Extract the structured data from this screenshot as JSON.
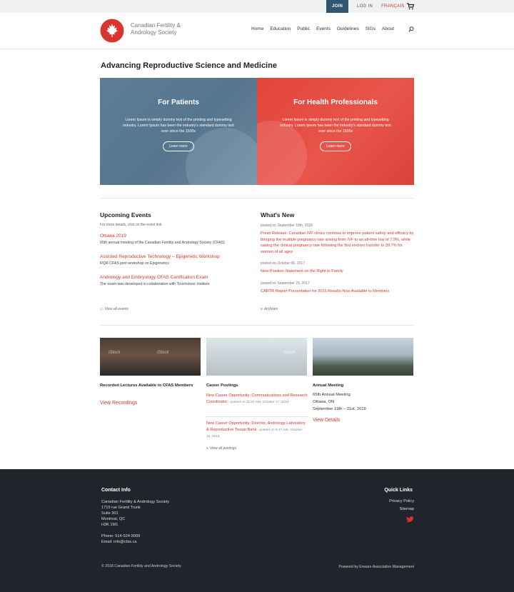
{
  "topbar": {
    "join": "JOIN",
    "login": "LOG IN",
    "lang": "FRANÇAIS",
    "cart_icon": "cart-icon"
  },
  "header": {
    "logo_text": "Canadian Fertility & Andrology Society",
    "nav": [
      "Home",
      "Education",
      "Public",
      "Events",
      "Guidelines",
      "SIGs",
      "About"
    ],
    "search_icon": "search-icon"
  },
  "page_title": "Advancing Reproductive Science and Medicine",
  "hero": [
    {
      "title": "For Patients",
      "text": "Lorem Ipsum is simply dummy text of the printing and typesetting industry. Lorem Ipsum has been the industry's standard dummy text ever since the 1500s",
      "button": "Learn more",
      "color": "#587891"
    },
    {
      "title": "For Health Professionals",
      "text": "Lorem Ipsum is simply dummy text of the printing and typesetting industry. Lorem Ipsum has been the industry's standard dummy text ever since the 1500s",
      "button": "Learn more",
      "color": "#e5483f"
    }
  ],
  "events": {
    "title": "Upcoming Events",
    "hint": "For more details, click on the event link.",
    "items": [
      {
        "title": "Ottawa 2019",
        "desc": "65th annual meeting of the Canadian Fertility and Andrology Society (CFAS)"
      },
      {
        "title": "Assisted Reproductive Technology – Epigenetic Workshop",
        "desc": "RQR-CFAS joint workshop on Epigenetics"
      },
      {
        "title": "Andrology and Embryology CFAS Certification Exam",
        "desc": "The exam was developed in collaboration with Touchstone Institute"
      }
    ],
    "view_all": "View all events"
  },
  "news": {
    "title": "What's New",
    "items": [
      {
        "posted": "posted on September 18th, 2018",
        "headline": "Press Release: Canadian IVF clinics continue to improve patient safety and efficacy by bringing the multiple pregnancy rate arising from IVF to an all-time low of 7.9%, while raising the clinical pregnancy rate following the first embryo transfer to 39.7% for women of all ages"
      },
      {
        "posted": "posted on October 06, 2017",
        "headline": "New Position Statement on the Right to Family"
      },
      {
        "posted": "posted on September 29, 2017",
        "headline": "CARTR Report Presentation for 2016 Results Now Available to Members"
      }
    ],
    "archives": "Archives"
  },
  "cards": {
    "recordings": {
      "title": "Recorded Lectures Available to CFAS Members",
      "link": "View Recordings"
    },
    "careers": {
      "title": "Career Postings",
      "posts": [
        {
          "title": "New Career Opportunity: Communications and Research Coordinator",
          "meta": " - posted on 11:22 AM, October 17, 2018"
        },
        {
          "title": "New Career Opportunity: Director, Andrology Laboratory & Reproductive Tissue Bank",
          "meta": " - posted on 8:17 AM, October 15, 2018"
        }
      ],
      "view_all": "View all postings"
    },
    "meeting": {
      "title": "Annual Meeting",
      "line1": "65th Annual Meeting",
      "line2": "Ottawa, ON",
      "line3": "September 19th – 21st, 2019",
      "link": "View Details"
    },
    "image_watermark": "iStock"
  },
  "footer": {
    "contact_title": "Contact Info",
    "address": [
      "Canadian Fertility & Andrology Society",
      "1719 rue Grand Trunk",
      "Suite 301",
      "Montreal, QC",
      "H3K 1M1"
    ],
    "phone": "Phone: 514-524-9009",
    "email": "Email: info@cfas.ca",
    "quick_title": "Quick Links",
    "links": [
      "Privacy Policy",
      "Sitemap"
    ],
    "copyright": "© 2018 Canadian Fertility and Andrology Society",
    "powered": "Powered by Exware Association Management"
  },
  "colors": {
    "accent": "#d8352f",
    "nav_dark": "#2f5573",
    "footer_bg": "#20252c"
  }
}
